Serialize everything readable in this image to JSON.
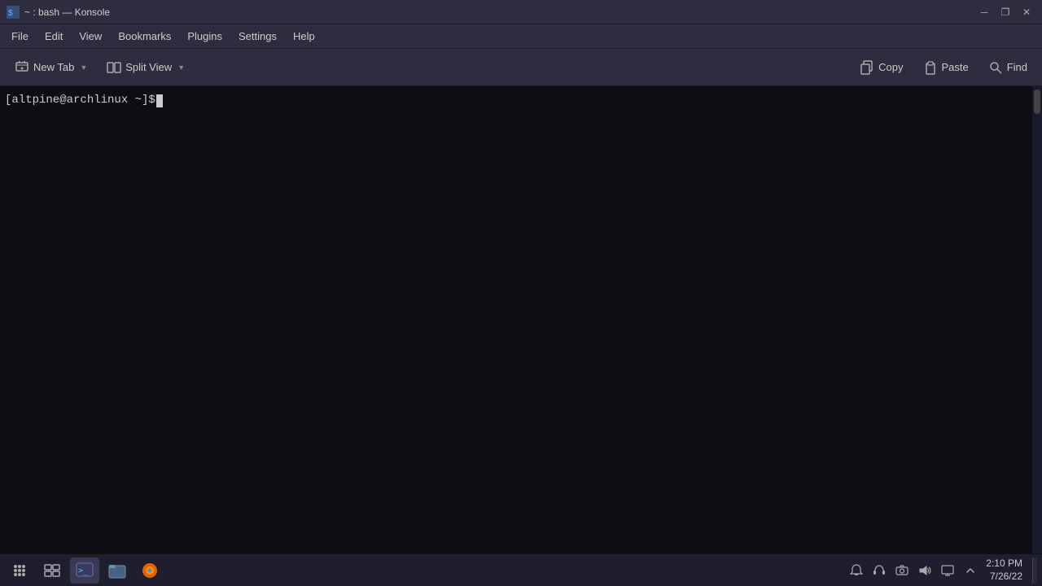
{
  "window": {
    "title": "~ : bash — Konsole",
    "icon": "terminal"
  },
  "titlebar": {
    "title": "~ : bash — Konsole",
    "controls": {
      "minimize": "─",
      "restore": "❐",
      "close": "✕"
    }
  },
  "menubar": {
    "items": [
      {
        "label": "File",
        "id": "file"
      },
      {
        "label": "Edit",
        "id": "edit"
      },
      {
        "label": "View",
        "id": "view"
      },
      {
        "label": "Bookmarks",
        "id": "bookmarks"
      },
      {
        "label": "Plugins",
        "id": "plugins"
      },
      {
        "label": "Settings",
        "id": "settings"
      },
      {
        "label": "Help",
        "id": "help"
      }
    ]
  },
  "toolbar": {
    "new_tab_label": "New Tab",
    "split_view_label": "Split View",
    "copy_label": "Copy",
    "paste_label": "Paste",
    "find_label": "Find"
  },
  "terminal": {
    "prompt": "[altpine@archlinux ~]$ "
  },
  "taskbar": {
    "clock": {
      "time": "2:10 PM",
      "date": "7/26/22"
    },
    "tray_icons": [
      "notify",
      "audio-headset",
      "camera",
      "volume",
      "display",
      "chevron-up"
    ]
  }
}
